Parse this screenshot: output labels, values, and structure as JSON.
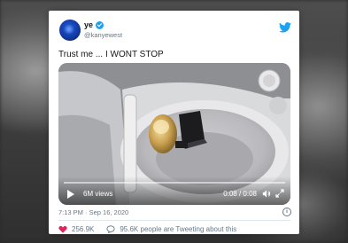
{
  "tweet": {
    "display_name": "ye",
    "handle": "@kanyewest",
    "text": "Trust me ... I WONT STOP",
    "timestamp": "7:13 PM · Sep 16, 2020",
    "likes": "256.9K",
    "tweeting_about": "95.6K people are Tweeting about this"
  },
  "video": {
    "views": "6M views",
    "time": "0:08 / 0:08",
    "progress_fraction": 1.0
  },
  "colors": {
    "twitter_blue": "#1da1f2",
    "heart_red": "#e0245e",
    "text_secondary": "#657786"
  },
  "icons": {
    "twitter_logo": "twitter-bird-icon",
    "verified": "verified-badge-icon",
    "play": "play-icon",
    "volume": "volume-icon",
    "fullscreen": "fullscreen-icon",
    "info": "info-icon",
    "like": "heart-icon",
    "reply": "speech-bubble-icon"
  }
}
